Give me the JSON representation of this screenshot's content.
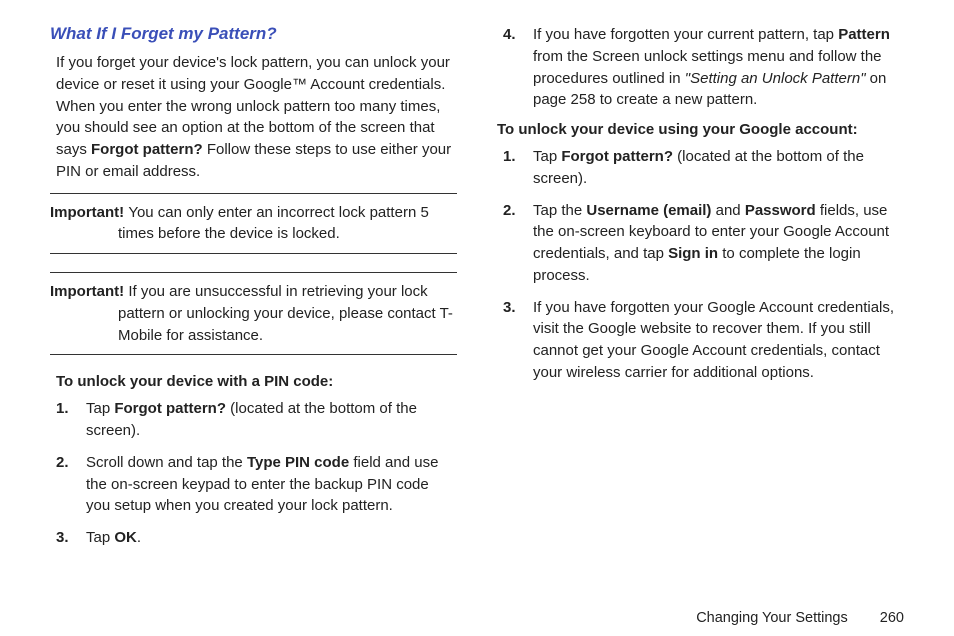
{
  "heading": "What If I Forget my Pattern?",
  "intro_parts": [
    "If you forget your device's lock pattern, you can unlock your device or reset it using your Google™ Account credentials. When you enter the wrong unlock pattern too many times, you should see an option at the bottom of the screen that says ",
    "Forgot pattern?",
    " Follow these steps to use either your PIN or email address."
  ],
  "important1": {
    "label": "Important! ",
    "text": "You can only enter an incorrect lock pattern 5 times before the device is locked."
  },
  "important2": {
    "label": "Important! ",
    "text": "If you are unsuccessful in retrieving your lock pattern or unlocking your device, please contact T-Mobile for assistance."
  },
  "pin_heading": "To unlock your device with a PIN code:",
  "pin_steps": [
    {
      "num": "1.",
      "pre": "Tap ",
      "b1": "Forgot pattern?",
      "post": " (located at the bottom of the screen)."
    },
    {
      "num": "2.",
      "pre": "Scroll down and tap the ",
      "b1": "Type PIN code",
      "post": " field and use the on-screen keypad to enter the backup PIN code you setup when you created your lock pattern."
    },
    {
      "num": "3.",
      "pre": "Tap ",
      "b1": "OK",
      "post": "."
    }
  ],
  "col2_step4": {
    "num": "4.",
    "pre": "If you have forgotten your current pattern, tap ",
    "b1": "Pattern",
    "mid": " from the Screen unlock settings menu and follow the procedures outlined in ",
    "ref": "\"Setting an Unlock Pattern\"",
    "post": " on page 258 to create a new pattern."
  },
  "google_heading": "To unlock your device using your Google account:",
  "google_steps": [
    {
      "num": "1.",
      "pre": "Tap ",
      "b1": "Forgot pattern?",
      "post": " (located at the bottom of the screen)."
    },
    {
      "num": "2.",
      "pre": "Tap the ",
      "b1": "Username (email)",
      "mid": " and ",
      "b2": "Password",
      "mid2": " fields, use the on-screen keyboard to enter your Google Account credentials, and tap ",
      "b3": "Sign in",
      "post": " to complete the login process."
    },
    {
      "num": "3.",
      "pre": "If you have forgotten your Google Account credentials, visit the Google website to recover them. If you still cannot get your Google Account credentials, contact your wireless carrier for additional options."
    }
  ],
  "footer_section": "Changing Your Settings",
  "footer_page": "260"
}
